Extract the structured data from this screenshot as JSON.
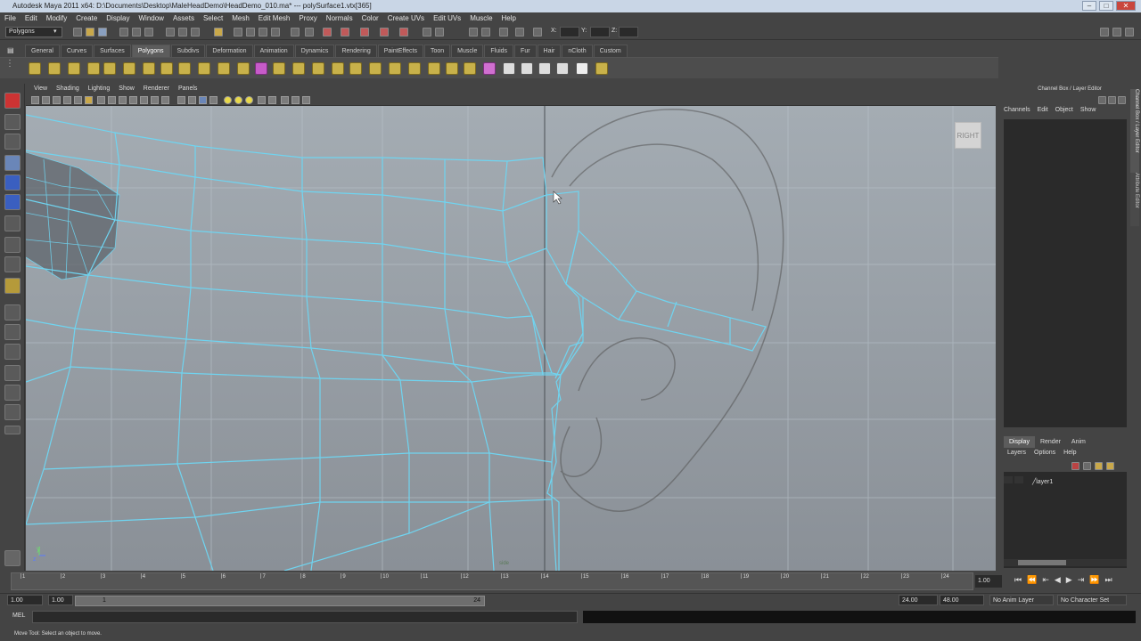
{
  "window": {
    "title": "Autodesk Maya 2011 x64: D:\\Documents\\Desktop\\MaleHeadDemo\\HeadDemo_010.ma*  ---  polySurface1.vtx[365]"
  },
  "menubar": [
    "File",
    "Edit",
    "Modify",
    "Create",
    "Display",
    "Window",
    "Assets",
    "Select",
    "Mesh",
    "Edit Mesh",
    "Proxy",
    "Normals",
    "Color",
    "Create UVs",
    "Edit UVs",
    "Muscle",
    "Help"
  ],
  "status_line": {
    "mode": "Polygons",
    "x_label": "X:",
    "y_label": "Y:",
    "z_label": "Z:"
  },
  "shelf_tabs": [
    "General",
    "Curves",
    "Surfaces",
    "Polygons",
    "Subdivs",
    "Deformation",
    "Animation",
    "Dynamics",
    "Rendering",
    "PaintEffects",
    "Toon",
    "Muscle",
    "Fluids",
    "Fur",
    "Hair",
    "nCloth",
    "Custom"
  ],
  "shelf_active": "Polygons",
  "panel_menu": [
    "View",
    "Shading",
    "Lighting",
    "Show",
    "Renderer",
    "Panels"
  ],
  "viewport": {
    "view_label": "RIGHT",
    "axis_y": "y",
    "axis_z": "z",
    "camera_label": "side"
  },
  "channel_box": {
    "title": "Channel Box / Layer Editor",
    "menu": [
      "Channels",
      "Edit",
      "Object",
      "Show"
    ],
    "side_tab_1": "Channel Box / Layer Editor",
    "side_tab_2": "Attribute Editor"
  },
  "layer_editor": {
    "tabs": [
      "Display",
      "Render",
      "Anim"
    ],
    "active_tab": "Display",
    "menu": [
      "Layers",
      "Options",
      "Help"
    ],
    "layers": [
      "layer1"
    ]
  },
  "time_slider": {
    "ticks": [
      "1",
      "2",
      "3",
      "4",
      "5",
      "6",
      "7",
      "8",
      "9",
      "10",
      "11",
      "12",
      "13",
      "14",
      "15",
      "16",
      "17",
      "18",
      "19",
      "20",
      "21",
      "22",
      "23",
      "24"
    ],
    "current_frame": "1.00"
  },
  "range_slider": {
    "start_time": "1.00",
    "start_range": "1.00",
    "range_start_label": "1",
    "range_end_label": "24",
    "end_range": "24.00",
    "end_time": "48.00",
    "anim_layer": "No Anim Layer",
    "character_set": "No Character Set"
  },
  "command_line": {
    "label": "MEL"
  },
  "help_line": "Move Tool: Select an object to move.",
  "colors": {
    "wire": "#6fd4f0",
    "viewport_bg": "#8f979e",
    "ui_bg": "#444444"
  }
}
